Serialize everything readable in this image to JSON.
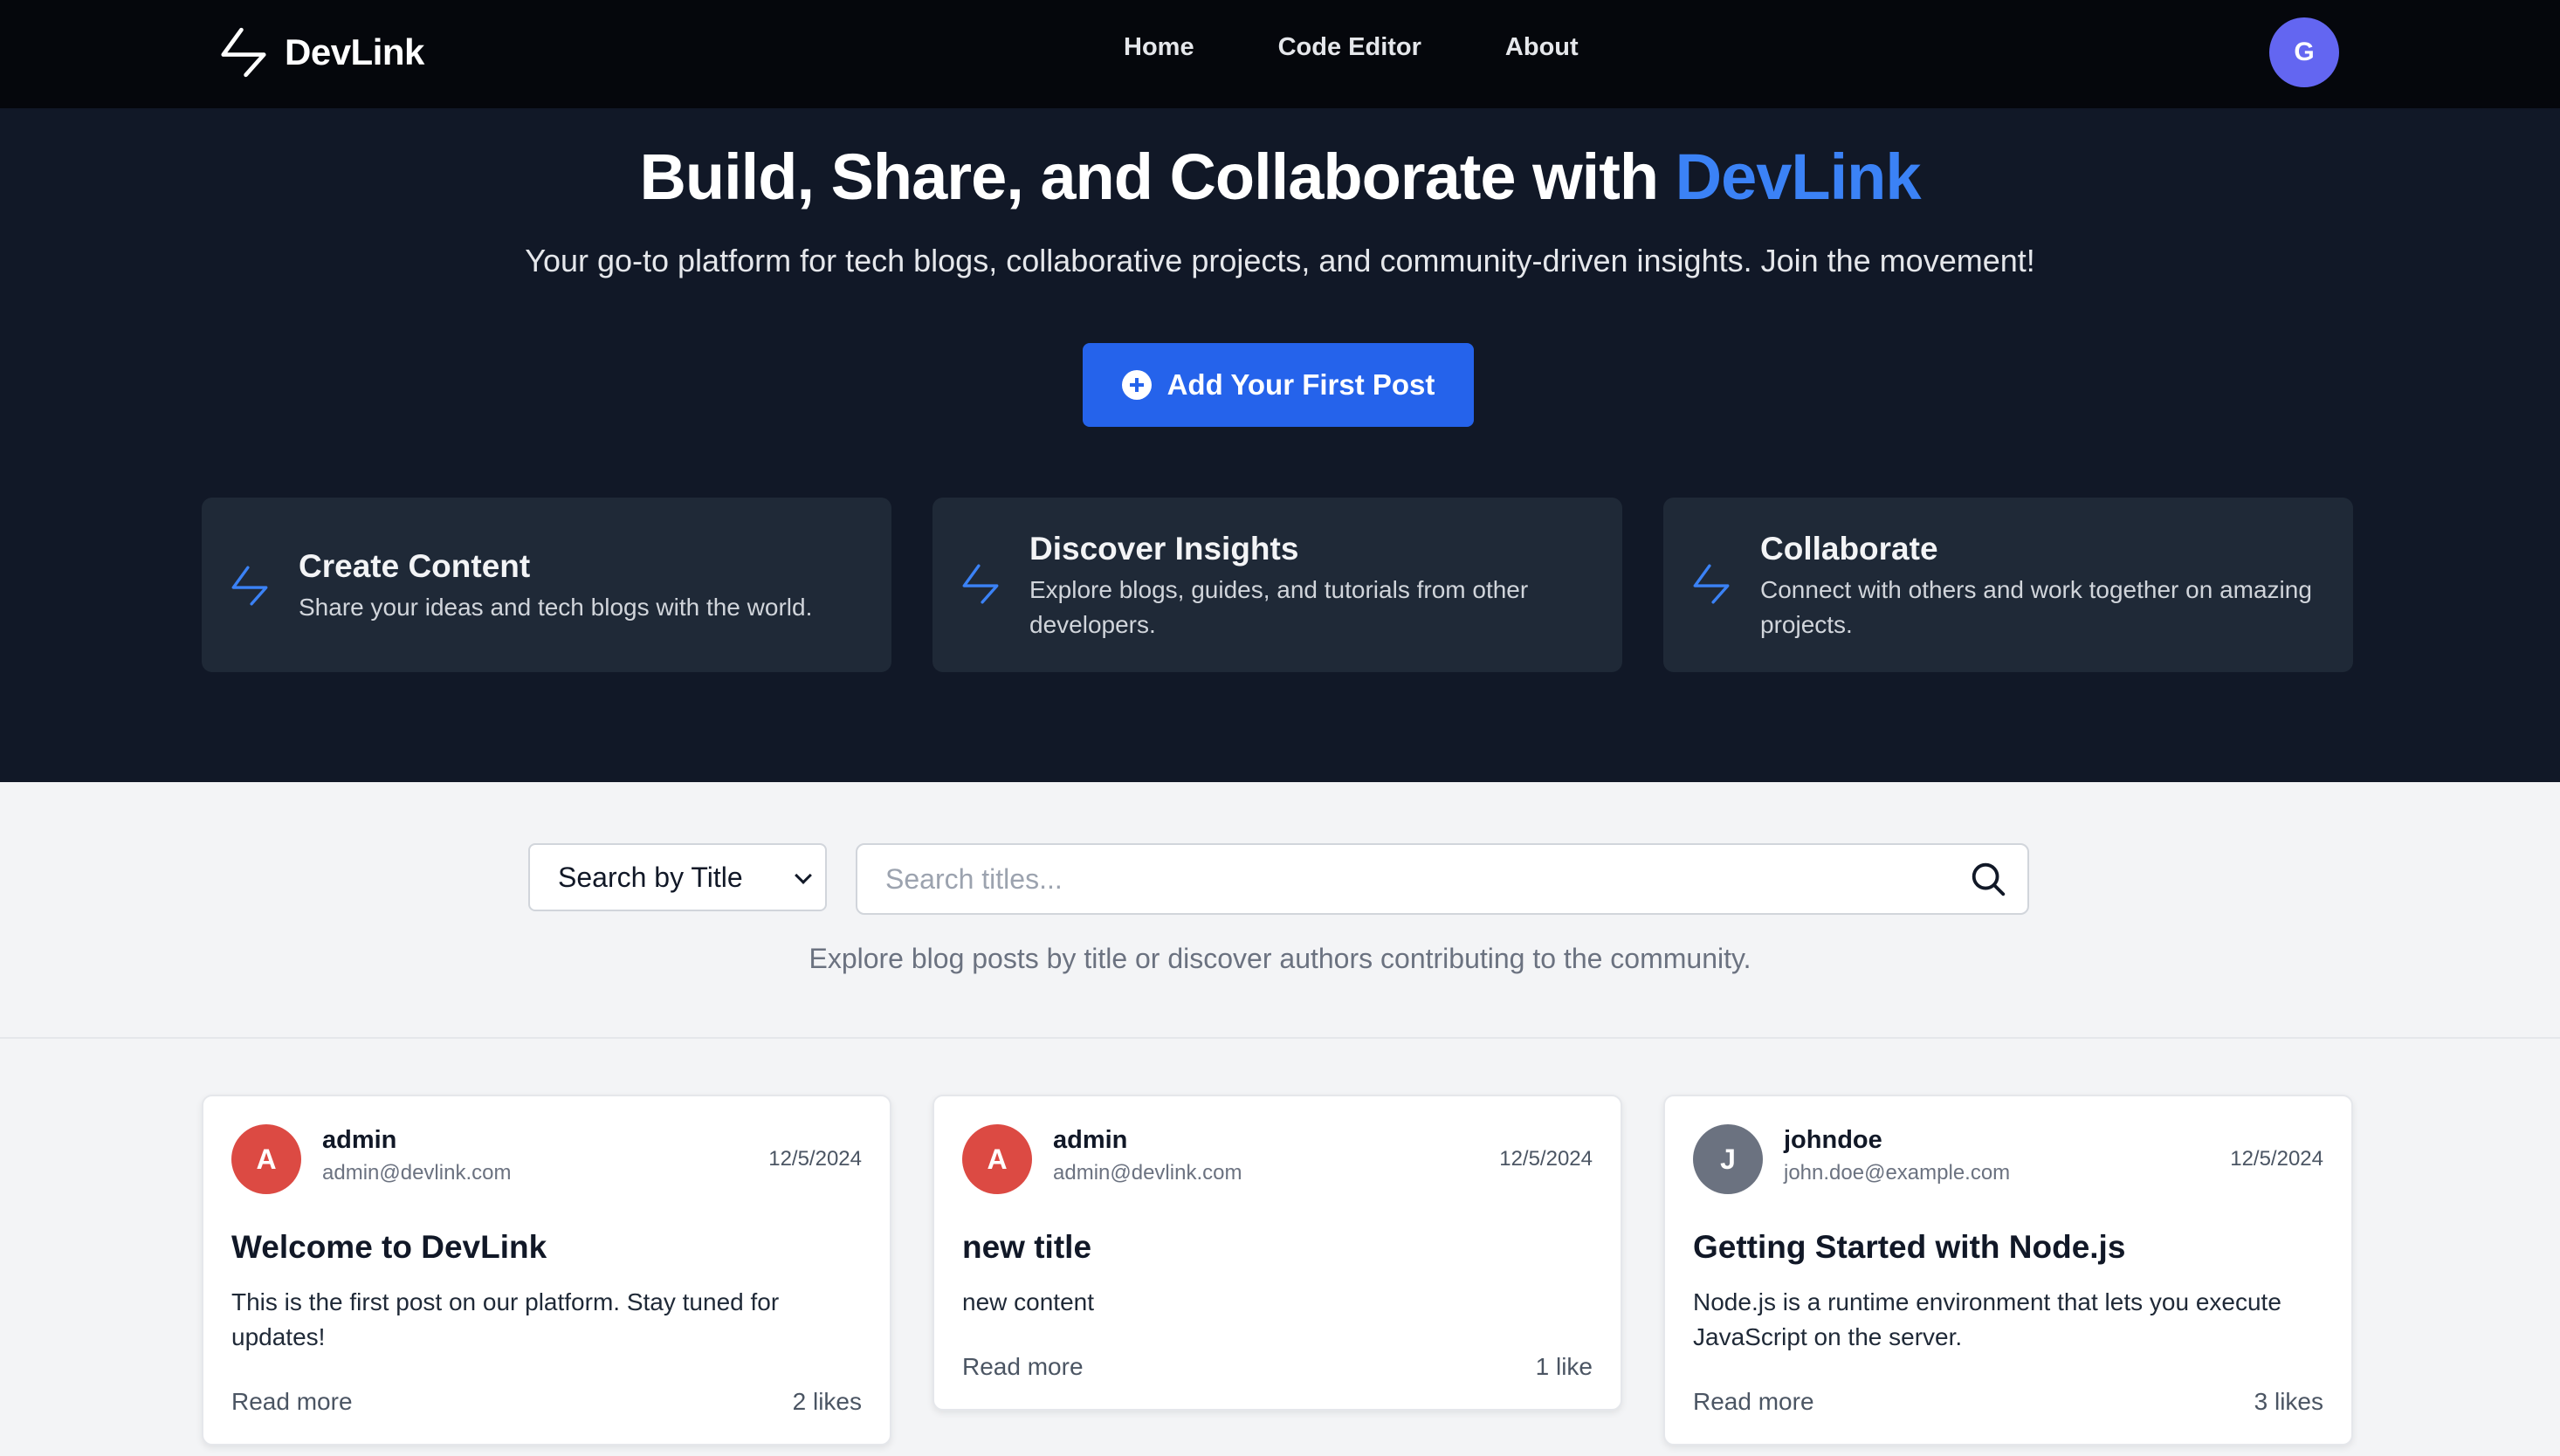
{
  "nav": {
    "brand": "DevLink",
    "links": [
      "Home",
      "Code Editor",
      "About"
    ],
    "avatar_initial": "G"
  },
  "hero": {
    "title_prefix": "Build, Share, and Collaborate with ",
    "title_accent": "DevLink",
    "subtitle": "Your go-to platform for tech blogs, collaborative projects, and community-driven insights. Join the movement!",
    "cta_label": "Add Your First Post",
    "features": [
      {
        "title": "Create Content",
        "desc": "Share your ideas and tech blogs with the world."
      },
      {
        "title": "Discover Insights",
        "desc": "Explore blogs, guides, and tutorials from other developers."
      },
      {
        "title": "Collaborate",
        "desc": "Connect with others and work together on amazing projects."
      }
    ]
  },
  "search": {
    "mode_selected": "Search by Title",
    "placeholder": "Search titles...",
    "hint": "Explore blog posts by title or discover authors contributing to the community."
  },
  "posts": [
    {
      "initial": "A",
      "avatar_color": "#dc4a43",
      "author": "admin",
      "email": "admin@devlink.com",
      "date": "12/5/2024",
      "title": "Welcome to DevLink",
      "body": "This is the first post on our platform. Stay tuned for updates!",
      "read_more": "Read more",
      "likes": "2 likes"
    },
    {
      "initial": "A",
      "avatar_color": "#dc4a43",
      "author": "admin",
      "email": "admin@devlink.com",
      "date": "12/5/2024",
      "title": "new title",
      "body": "new content",
      "read_more": "Read more",
      "likes": "1 like"
    },
    {
      "initial": "J",
      "avatar_color": "#6b7280",
      "author": "johndoe",
      "email": "john.doe@example.com",
      "date": "12/5/2024",
      "title": "Getting Started with Node.js",
      "body": "Node.js is a runtime environment that lets you execute JavaScript on the server.",
      "read_more": "Read more",
      "likes": "3 likes"
    }
  ],
  "colors": {
    "nav_bg": "#05070c",
    "hero_bg": "#111827",
    "accent": "#3b82f6",
    "cta": "#2563eb",
    "avatar_user": "#6366f1"
  },
  "icons": {
    "brand": "bolt-icon",
    "cta": "plus-circle-icon",
    "feature": "bolt-icon",
    "search": "search-icon",
    "select": "chevron-down-icon"
  }
}
